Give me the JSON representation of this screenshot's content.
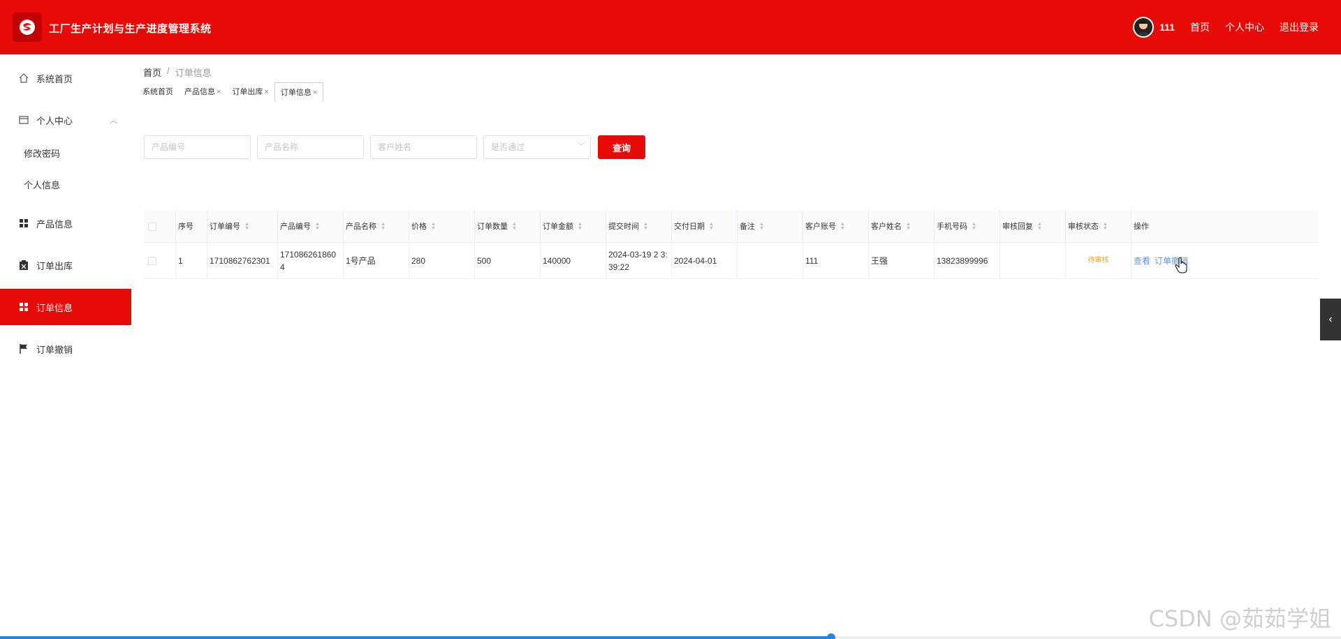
{
  "header": {
    "title": "工厂生产计划与生产进度管理系统",
    "username": "111",
    "links": [
      "首页",
      "个人中心",
      "退出登录"
    ],
    "brand_color": "#e60b06"
  },
  "sidebar": {
    "items": [
      {
        "label": "系统首页",
        "icon": "home-icon"
      },
      {
        "label": "个人中心",
        "icon": "profile-card-icon"
      },
      {
        "label": "产品信息",
        "icon": "grid-icon"
      },
      {
        "label": "订单出库",
        "icon": "clipboard-icon"
      },
      {
        "label": "订单信息",
        "icon": "grid-icon",
        "active": true
      },
      {
        "label": "订单撤销",
        "icon": "flag-icon"
      }
    ],
    "sub_items": [
      "修改密码",
      "个人信息"
    ]
  },
  "breadcrumb": {
    "home": "首页",
    "separator": "/",
    "current": "订单信息"
  },
  "tabs": [
    "系统首页",
    "产品信息",
    "订单出库",
    "订单信息"
  ],
  "search": {
    "product_no_placeholder": "产品编号",
    "product_name_placeholder": "产品名称",
    "customer_name_placeholder": "客户姓名",
    "approved_placeholder": "是否通过",
    "query_label": "查询"
  },
  "table": {
    "columns": [
      "序号",
      "订单编号",
      "产品编号",
      "产品名称",
      "价格",
      "订单数量",
      "订单金额",
      "提交时间",
      "交付日期",
      "备注",
      "客户账号",
      "客户姓名",
      "手机号码",
      "审核回复",
      "审核状态",
      "操作"
    ],
    "rows": [
      {
        "index": "1",
        "order_no": "1710862762301",
        "product_no": "171086261860 4",
        "product_name": "1号产品",
        "price": "280",
        "quantity": "500",
        "amount": "140000",
        "submit_time": "2024-03-19 2 3:39:22",
        "delivery_date": "2024-04-01",
        "remark": "",
        "customer_account": "111",
        "customer_name": "王强",
        "phone": "13823899996",
        "review_reply": "",
        "review_status": "待审核",
        "actions": [
          "查看",
          "订单撤销"
        ]
      }
    ]
  },
  "watermark": "CSDN @茹茹学姐",
  "playback_progress": 0.62
}
